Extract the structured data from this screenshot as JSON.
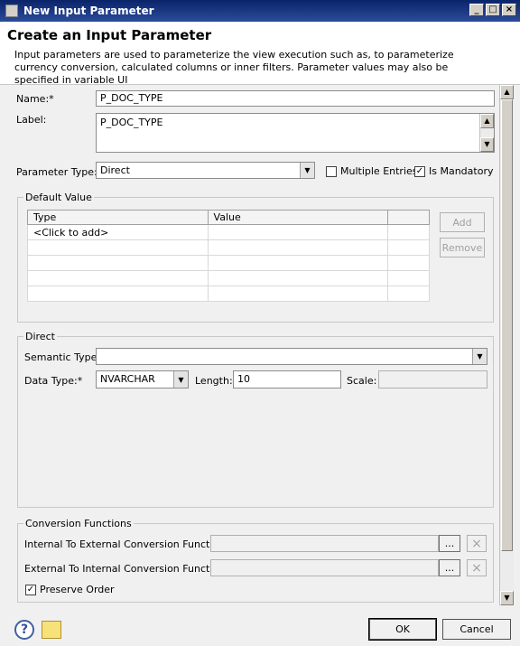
{
  "window": {
    "title": "New Input Parameter",
    "minimize": "_",
    "maximize": "□",
    "close": "×"
  },
  "header": {
    "title": "Create an Input Parameter",
    "description": "Input parameters are used to parameterize the view execution such as, to parameterize currency conversion, calculated columns or inner filters. Parameter values may also be specified in variable UI"
  },
  "form": {
    "name_label": "Name:*",
    "name_value": "P_DOC_TYPE",
    "label_label": "Label:",
    "label_value": "P_DOC_TYPE",
    "param_type_label": "Parameter Type:",
    "param_type_value": "Direct",
    "multiple_entries_label": "Multiple Entries",
    "multiple_entries_checked": false,
    "is_mandatory_label": "Is Mandatory",
    "is_mandatory_checked": true
  },
  "default_value": {
    "title": "Default Value",
    "columns": [
      "Type",
      "Value"
    ],
    "add_row_text": "<Click to add>",
    "add_button": "Add",
    "remove_button": "Remove"
  },
  "direct": {
    "title": "Direct",
    "semantic_type_label": "Semantic Type:",
    "semantic_type_value": "",
    "data_type_label": "Data Type:*",
    "data_type_value": "NVARCHAR",
    "length_label": "Length:",
    "length_value": "10",
    "scale_label": "Scale:",
    "scale_value": ""
  },
  "conversion": {
    "title": "Conversion Functions",
    "int_to_ext_label": "Internal To External Conversion Function:",
    "ext_to_int_label": "External To Internal Conversion Function:",
    "browse_label": "...",
    "clear_label": "×",
    "preserve_order_label": "Preserve Order",
    "preserve_order_checked": true
  },
  "footer": {
    "help_icon": "?",
    "ok_label": "OK",
    "cancel_label": "Cancel"
  },
  "glyphs": {
    "check": "✓",
    "down": "▼",
    "up": "▲"
  }
}
